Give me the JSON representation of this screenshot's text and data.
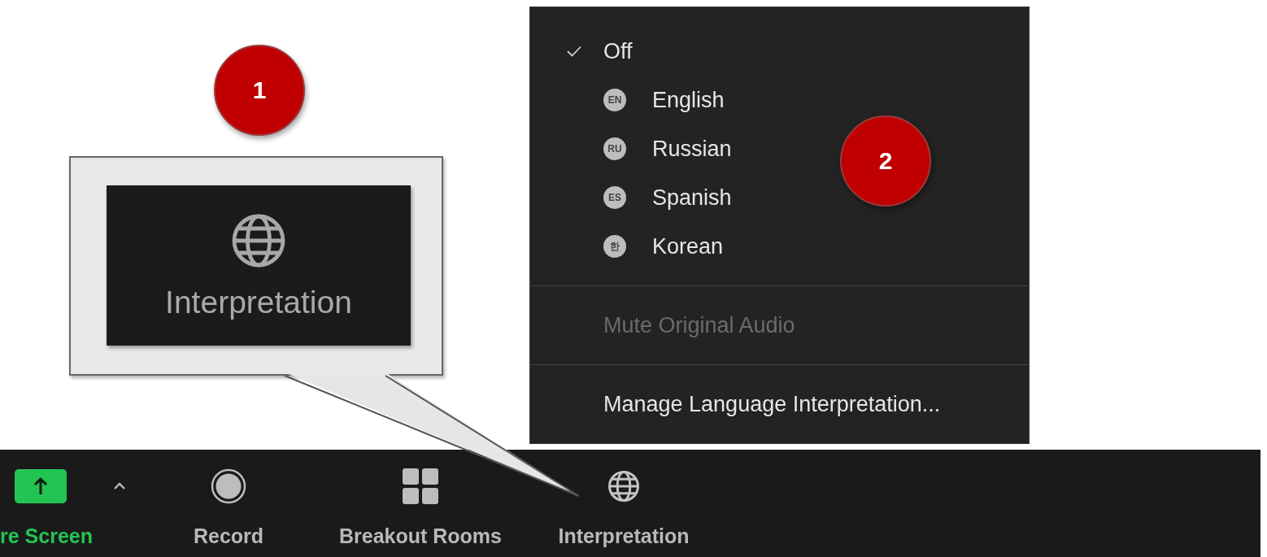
{
  "callout": {
    "badge": "1",
    "label": "Interpretation"
  },
  "menu": {
    "badge": "2",
    "sections": [
      {
        "items": [
          {
            "kind": "option",
            "label": "Off",
            "checked": true
          },
          {
            "kind": "language",
            "code": "EN",
            "label": "English",
            "checked": false
          },
          {
            "kind": "language",
            "code": "RU",
            "label": "Russian",
            "checked": false
          },
          {
            "kind": "language",
            "code": "ES",
            "label": "Spanish",
            "checked": false
          },
          {
            "kind": "language",
            "code": "한",
            "label": "Korean",
            "checked": false
          }
        ]
      },
      {
        "items": [
          {
            "kind": "action",
            "label": "Mute Original Audio",
            "disabled": true
          }
        ]
      },
      {
        "items": [
          {
            "kind": "action",
            "label": "Manage Language Interpretation...",
            "disabled": false
          }
        ]
      }
    ]
  },
  "toolbar": {
    "items": [
      {
        "kind": "share",
        "label": "re Screen"
      },
      {
        "kind": "caret"
      },
      {
        "kind": "record",
        "label": "Record"
      },
      {
        "kind": "breakout",
        "label": "Breakout Rooms"
      },
      {
        "kind": "interpretation",
        "label": "Interpretation"
      }
    ]
  }
}
